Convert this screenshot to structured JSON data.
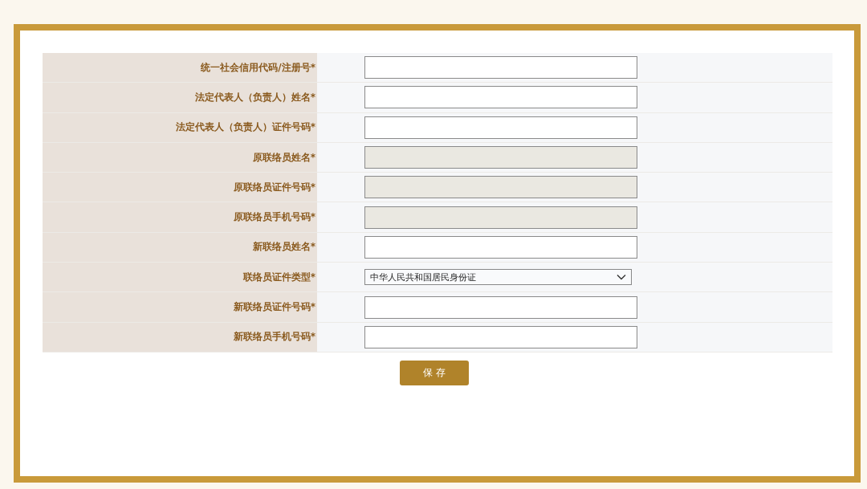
{
  "form": {
    "fields": [
      {
        "label": "统一社会信用代码/注册号*",
        "kind": "text",
        "disabled": false
      },
      {
        "label": "法定代表人（负责人）姓名*",
        "kind": "text",
        "disabled": false
      },
      {
        "label": "法定代表人（负责人）证件号码*",
        "kind": "text",
        "disabled": false
      },
      {
        "label": "原联络员姓名*",
        "kind": "text",
        "disabled": true
      },
      {
        "label": "原联络员证件号码*",
        "kind": "text",
        "disabled": true
      },
      {
        "label": "原联络员手机号码*",
        "kind": "text",
        "disabled": true
      },
      {
        "label": "新联络员姓名*",
        "kind": "text",
        "disabled": false
      },
      {
        "label": "联络员证件类型*",
        "kind": "select",
        "value": "中华人民共和国居民身份证"
      },
      {
        "label": "新联络员证件号码*",
        "kind": "text",
        "disabled": false
      },
      {
        "label": "新联络员手机号码*",
        "kind": "text",
        "disabled": false
      }
    ]
  },
  "save_button": "保 存"
}
